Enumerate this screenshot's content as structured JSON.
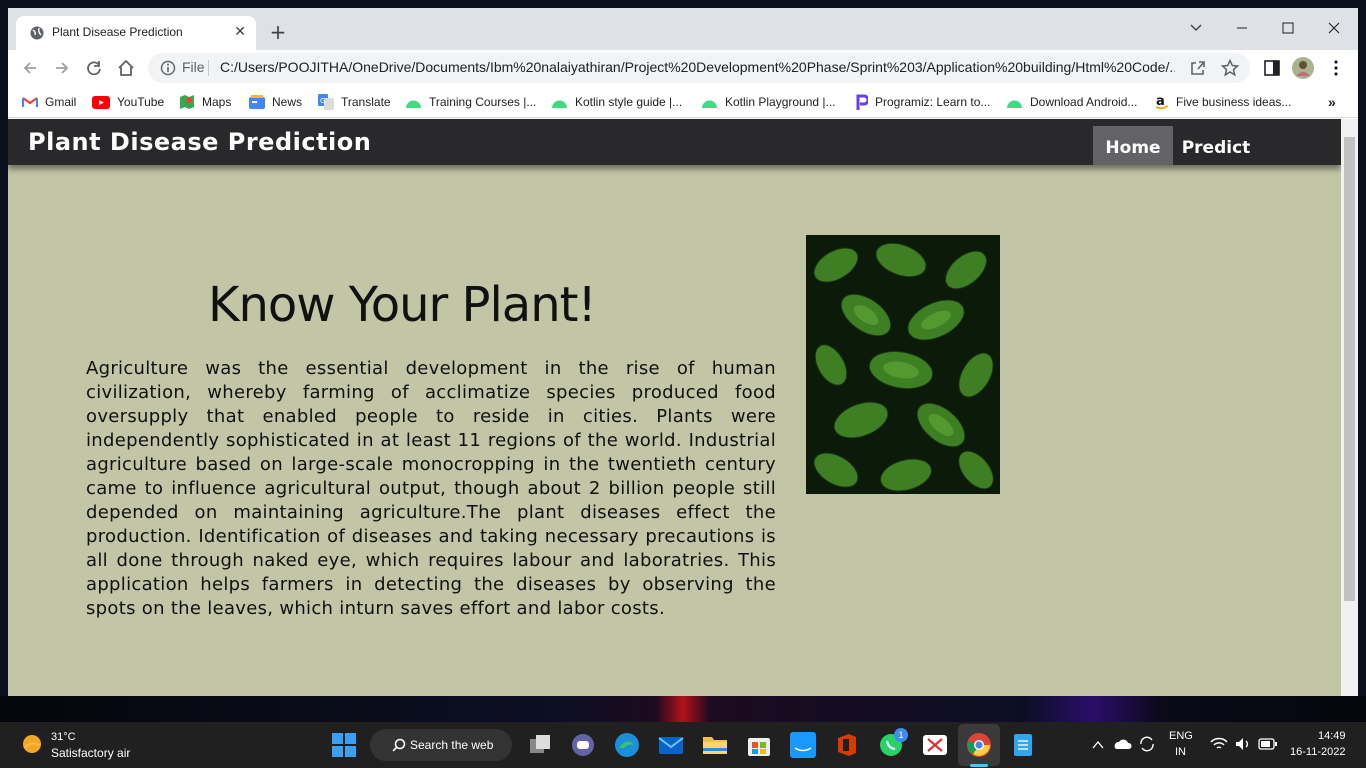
{
  "browser": {
    "tab_title": "Plant Disease Prediction",
    "omnibox_label": "File",
    "url": "C:/Users/POOJITHA/OneDrive/Documents/Ibm%20nalaiyathiran/Project%20Development%20Phase/Sprint%203/Application%20building/Html%20Code/..."
  },
  "bookmarks": [
    {
      "label": "Gmail",
      "icon": "gmail-icon"
    },
    {
      "label": "YouTube",
      "icon": "youtube-icon"
    },
    {
      "label": "Maps",
      "icon": "maps-icon"
    },
    {
      "label": "News",
      "icon": "news-icon"
    },
    {
      "label": "Translate",
      "icon": "translate-icon"
    },
    {
      "label": "Training Courses |...",
      "icon": "android-icon"
    },
    {
      "label": "Kotlin style guide |...",
      "icon": "android-icon"
    },
    {
      "label": "Kotlin Playground |...",
      "icon": "android-icon"
    },
    {
      "label": "Programiz: Learn to...",
      "icon": "programiz-icon"
    },
    {
      "label": "Download Android...",
      "icon": "android-icon"
    },
    {
      "label": "Five business ideas...",
      "icon": "amazon-icon"
    }
  ],
  "site": {
    "brand": "Plant Disease Prediction",
    "nav": {
      "home": "Home",
      "predict": "Predict"
    },
    "hero_title": "Know Your Plant!",
    "hero_text": "Agriculture was the essential development in the rise of human civilization, whereby farming of acclimatize species produced food oversupply that enabled people to reside in cities. Plants were independently sophisticated in at least 11 regions of the world. Industrial agriculture based on large-scale monocropping in the twentieth century came to influence agricultural output, though about 2 billion people still depended on maintaining agriculture.The plant diseases effect the production. Identification of diseases and taking necessary precautions is all done through naked eye, which requires labour and laboratries. This application helps farmers in detecting the diseases by observing the spots on the leaves, which inturn saves effort and labor costs."
  },
  "taskbar": {
    "weather_temp": "31°C",
    "weather_desc": "Satisfactory air",
    "search_label": "Search the web",
    "whatsapp_badge": "1",
    "lang_top": "ENG",
    "lang_bottom": "IN",
    "time": "14:49",
    "date": "16-11-2022"
  },
  "colors": {
    "page_bg": "#c2c5a6",
    "navbar_bg": "#29292b",
    "nav_active": "#636367"
  }
}
